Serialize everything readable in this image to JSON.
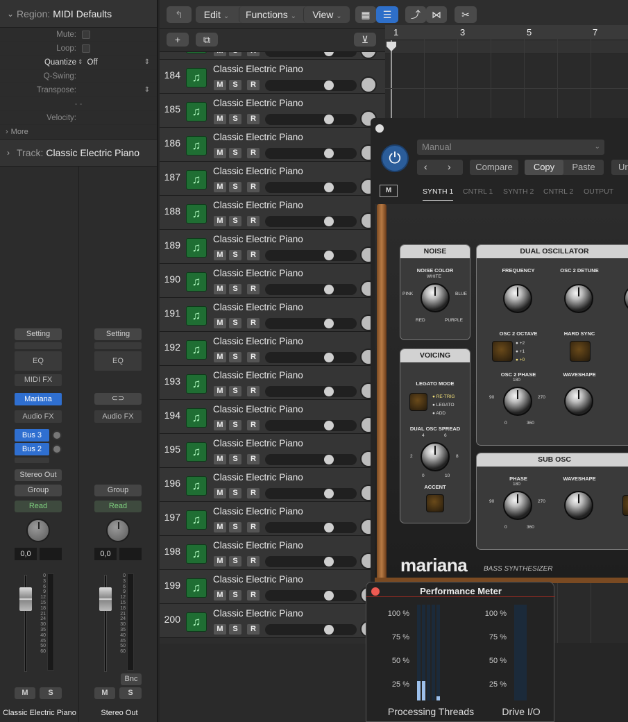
{
  "inspector": {
    "region_label": "Region:",
    "region_name": "MIDI Defaults",
    "params": [
      {
        "label": "Mute:",
        "value": ""
      },
      {
        "label": "Loop:",
        "value": ""
      },
      {
        "label": "Quantize",
        "value": "Off"
      },
      {
        "label": "Q-Swing:",
        "value": ""
      },
      {
        "label": "Transpose:",
        "value": ""
      },
      {
        "label": "",
        "value": "- -"
      },
      {
        "label": "Velocity:",
        "value": ""
      }
    ],
    "more_label": "More",
    "track_label": "Track:",
    "track_name": "Classic Electric Piano",
    "strip1": {
      "setting": "Setting",
      "eq": "EQ",
      "midi_fx": "MIDI FX",
      "instrument": "Mariana",
      "audio_fx": "Audio FX",
      "send1": "Bus 3",
      "send2": "Bus 2",
      "output": "Stereo Out",
      "group": "Group",
      "automation": "Read",
      "pan_value": "0,0",
      "mute": "M",
      "solo": "S",
      "name": "Classic Electric Piano"
    },
    "strip2": {
      "setting": "Setting",
      "eq": "EQ",
      "audio_fx": "Audio FX",
      "group": "Group",
      "automation": "Read",
      "pan_value": "0,0",
      "bounce": "Bnc",
      "mute": "M",
      "solo": "S",
      "name": "Stereo Out"
    },
    "meter_scale": [
      "0",
      "3",
      "6",
      "9",
      "12",
      "15",
      "18",
      "21",
      "24",
      "30",
      "35",
      "40",
      "45",
      "50",
      "60"
    ]
  },
  "toolbar": {
    "edit": "Edit",
    "functions": "Functions",
    "view": "View"
  },
  "ruler": {
    "marks": [
      "1",
      "3",
      "5",
      "7"
    ]
  },
  "tracks": [
    {
      "num": "184",
      "name": "Classic Electric Piano"
    },
    {
      "num": "185",
      "name": "Classic Electric Piano"
    },
    {
      "num": "186",
      "name": "Classic Electric Piano"
    },
    {
      "num": "187",
      "name": "Classic Electric Piano"
    },
    {
      "num": "188",
      "name": "Classic Electric Piano"
    },
    {
      "num": "189",
      "name": "Classic Electric Piano"
    },
    {
      "num": "190",
      "name": "Classic Electric Piano"
    },
    {
      "num": "191",
      "name": "Classic Electric Piano"
    },
    {
      "num": "192",
      "name": "Classic Electric Piano"
    },
    {
      "num": "193",
      "name": "Classic Electric Piano"
    },
    {
      "num": "194",
      "name": "Classic Electric Piano"
    },
    {
      "num": "195",
      "name": "Classic Electric Piano"
    },
    {
      "num": "196",
      "name": "Classic Electric Piano"
    },
    {
      "num": "197",
      "name": "Classic Electric Piano"
    },
    {
      "num": "198",
      "name": "Classic Electric Piano"
    },
    {
      "num": "199",
      "name": "Classic Electric Piano"
    },
    {
      "num": "200",
      "name": "Classic Electric Piano"
    }
  ],
  "track_buttons": {
    "mute": "M",
    "solo": "S",
    "record": "R"
  },
  "plugin": {
    "preset": "Manual",
    "compare": "Compare",
    "copy": "Copy",
    "paste": "Paste",
    "undo_partial": "Ur",
    "m_button": "M",
    "tabs": [
      "SYNTH 1",
      "CNTRL 1",
      "SYNTH 2",
      "CNTRL 2",
      "OUTPUT"
    ],
    "noise": {
      "title": "NOISE",
      "knob_label": "NOISE COLOR",
      "white": "WHITE",
      "pink": "PINK",
      "blue": "BLUE",
      "red": "RED",
      "purple": "PURPLE"
    },
    "voicing": {
      "title": "VOICING",
      "legato_mode": "LEGATO MODE",
      "retrig": "RE-TRIG",
      "legato": "LEGATO",
      "add": "ADD",
      "spread": "DUAL OSC SPREAD",
      "accent": "ACCENT",
      "s4": "4",
      "s6": "6",
      "s2": "2",
      "s8": "8",
      "s0": "0",
      "s10": "10"
    },
    "dual_osc": {
      "title": "DUAL OSCILLATOR",
      "frequency": "FREQUENCY",
      "detune": "OSC 2 DETUNE",
      "octave": "OSC 2 OCTAVE",
      "oct_p2": "+2",
      "oct_p1": "+1",
      "oct_0": "+0",
      "hard_sync": "HARD SYNC",
      "phase": "OSC 2 PHASE",
      "waveshape": "WAVESHAPE",
      "p180": "180",
      "p90": "90",
      "p270": "270",
      "p0": "0",
      "p360": "360"
    },
    "sub_osc": {
      "title": "SUB OSC",
      "phase": "PHASE",
      "waveshape": "WAVESHAPE",
      "p180": "180",
      "p90": "90",
      "p270": "270",
      "p0": "0",
      "p360": "360"
    },
    "logo": "mariana",
    "subtitle": "BASS SYNTHESIZER"
  },
  "perf_meter": {
    "title": "Performance Meter",
    "ticks": [
      "100 %",
      "75 %",
      "50 %",
      "25 %"
    ],
    "left_label": "Processing Threads",
    "right_label": "Drive I/O",
    "thread_levels": [
      0.2,
      0.2,
      0.0,
      0.0,
      0.04
    ]
  }
}
